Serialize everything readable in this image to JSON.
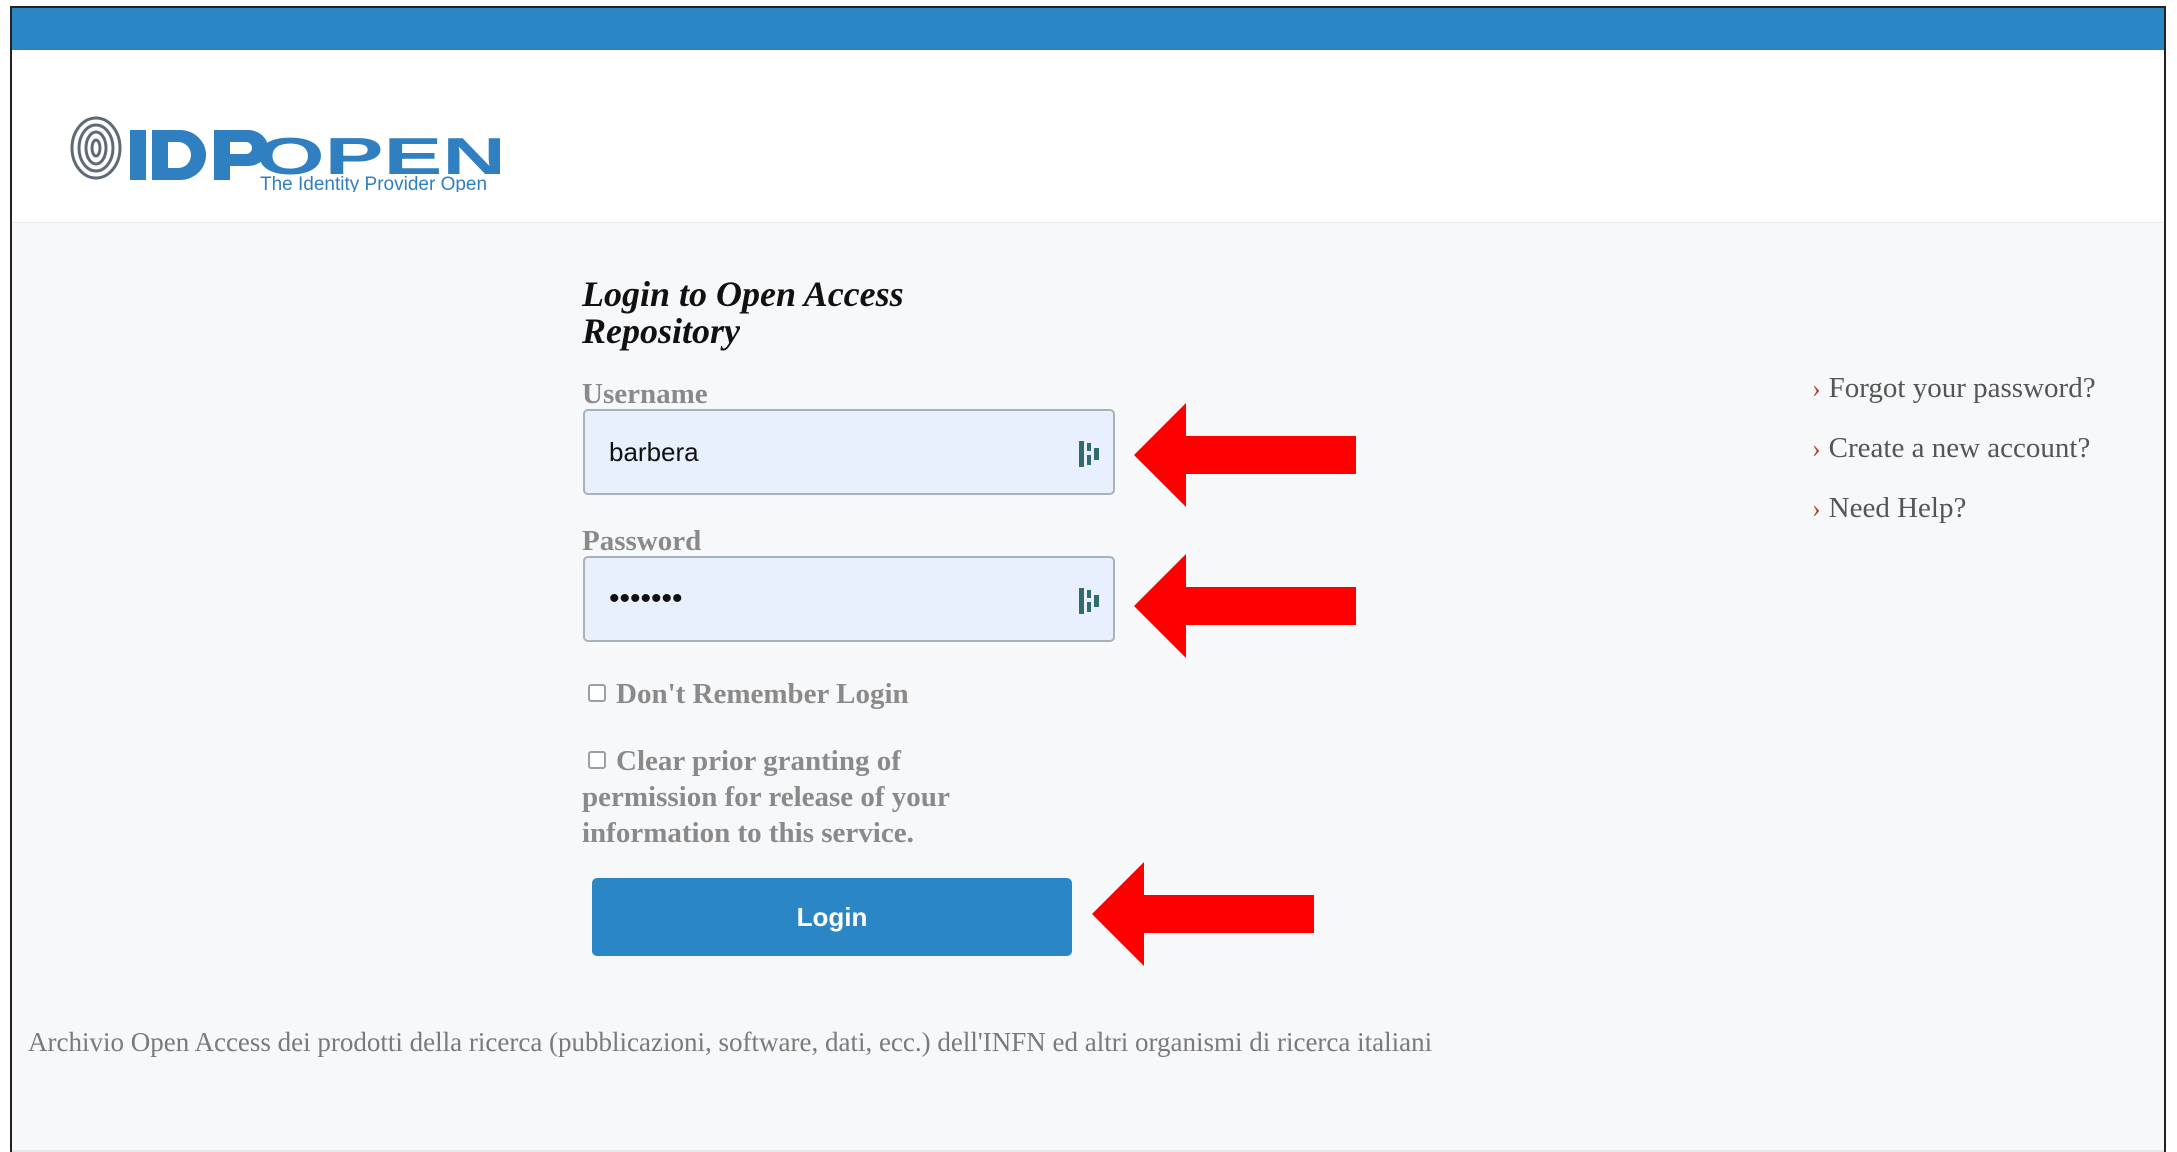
{
  "logo": {
    "wordmark": "IDPOPEN",
    "tagline": "The Identity Provider Open"
  },
  "login": {
    "title": "Login to Open Access Repository",
    "username_label": "Username",
    "username_value": "barbera",
    "password_label": "Password",
    "password_value": "•••••••",
    "dont_remember_label": "Don't Remember Login",
    "clear_grants_label": "Clear prior granting of permission for release of your information to this service.",
    "button_label": "Login"
  },
  "links": {
    "forgot_password": "Forgot your password?",
    "create_account": "Create a new account?",
    "need_help": "Need Help?"
  },
  "footer": {
    "description": "Archivio Open Access dei prodotti della ricerca (pubblicazioni, software, dati, ecc.) dell'INFN ed altri organismi di ricerca italiani"
  },
  "colors": {
    "accent": "#2b86c6",
    "annotation_arrow": "#ff0000",
    "link_chevron": "#b24a2c"
  },
  "icons": {
    "field_icon": "keepassxc-icon",
    "arrow": "red-arrow-left"
  }
}
